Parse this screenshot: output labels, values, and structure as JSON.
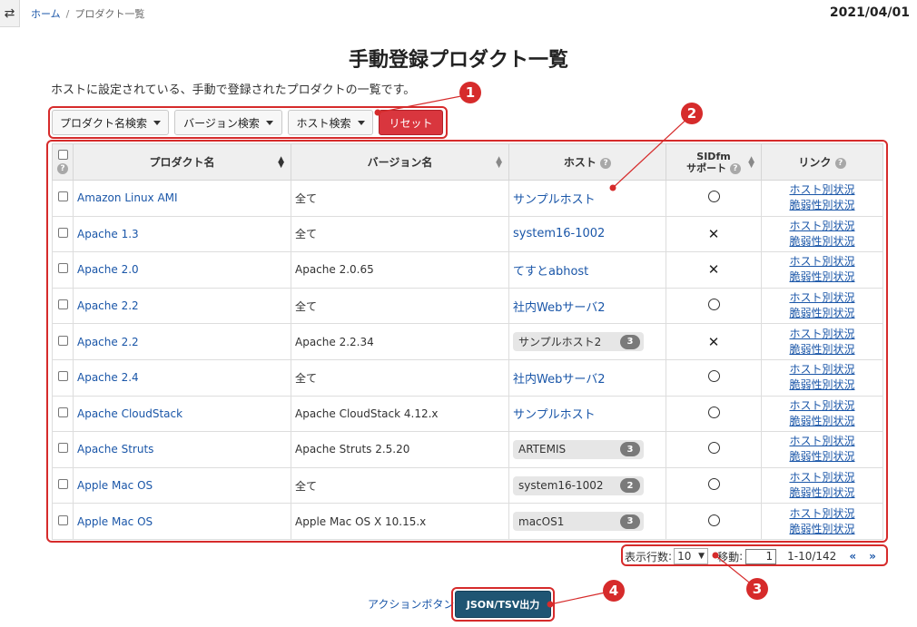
{
  "header": {
    "breadcrumb": {
      "home": "ホーム",
      "separator": "/",
      "current": "プロダクト一覧"
    },
    "date": "2021/04/01"
  },
  "page": {
    "title": "手動登録プロダクト一覧",
    "description": "ホストに設定されている、手動で登録されたプロダクトの一覧です。"
  },
  "toolbar": {
    "product_search": "プロダクト名検索",
    "version_search": "バージョン検索",
    "host_search": "ホスト検索",
    "reset": "リセット"
  },
  "markers": {
    "m1": "1",
    "m2": "2",
    "m3": "3",
    "m4": "4"
  },
  "table": {
    "headers": {
      "product": "プロダクト名",
      "version": "バージョン名",
      "host": "ホスト",
      "support_line1": "SIDfm",
      "support_line2": "サポート",
      "link": "リンク"
    },
    "link_labels": {
      "host_status": "ホスト別状況",
      "vuln_status": "脆弱性別状況"
    },
    "rows": [
      {
        "product": "Amazon Linux AMI",
        "version": "全て",
        "host": "サンプルホスト",
        "host_count": "",
        "support": "circle"
      },
      {
        "product": "Apache 1.3",
        "version": "全て",
        "host": "system16-1002",
        "host_count": "",
        "support": "cross"
      },
      {
        "product": "Apache 2.0",
        "version": "Apache 2.0.65",
        "host": "てすとabhost",
        "host_count": "",
        "support": "cross"
      },
      {
        "product": "Apache 2.2",
        "version": "全て",
        "host": "社内Webサーバ2",
        "host_count": "",
        "support": "circle"
      },
      {
        "product": "Apache 2.2",
        "version": "Apache 2.2.34",
        "host": "サンプルホスト2",
        "host_count": "3",
        "support": "cross"
      },
      {
        "product": "Apache 2.4",
        "version": "全て",
        "host": "社内Webサーバ2",
        "host_count": "",
        "support": "circle"
      },
      {
        "product": "Apache CloudStack",
        "version": "Apache CloudStack 4.12.x",
        "host": "サンプルホスト",
        "host_count": "",
        "support": "circle"
      },
      {
        "product": "Apache Struts",
        "version": "Apache Struts 2.5.20",
        "host": "ARTEMIS",
        "host_count": "3",
        "support": "circle"
      },
      {
        "product": "Apple Mac OS",
        "version": "全て",
        "host": "system16-1002",
        "host_count": "2",
        "support": "circle"
      },
      {
        "product": "Apple Mac OS",
        "version": "Apple Mac OS X 10.15.x",
        "host": "macOS1",
        "host_count": "3",
        "support": "circle"
      }
    ]
  },
  "pager": {
    "rows_label": "表示行数",
    "rows_value": "10",
    "goto_label": "移動",
    "goto_value": "1",
    "range": "1-10/142",
    "prev_symbol": "«",
    "next_symbol": "»"
  },
  "footer": {
    "action_label": "アクションボタン",
    "export_button": "JSON/TSV出力"
  },
  "colors": {
    "accent_red": "#d62b2b",
    "link_blue": "#1a56a8",
    "export_bg": "#1f5573"
  },
  "icons": {
    "toggle": "swap-arrows-icon",
    "help": "question-circle-icon",
    "sort": "sort-arrows-icon"
  }
}
